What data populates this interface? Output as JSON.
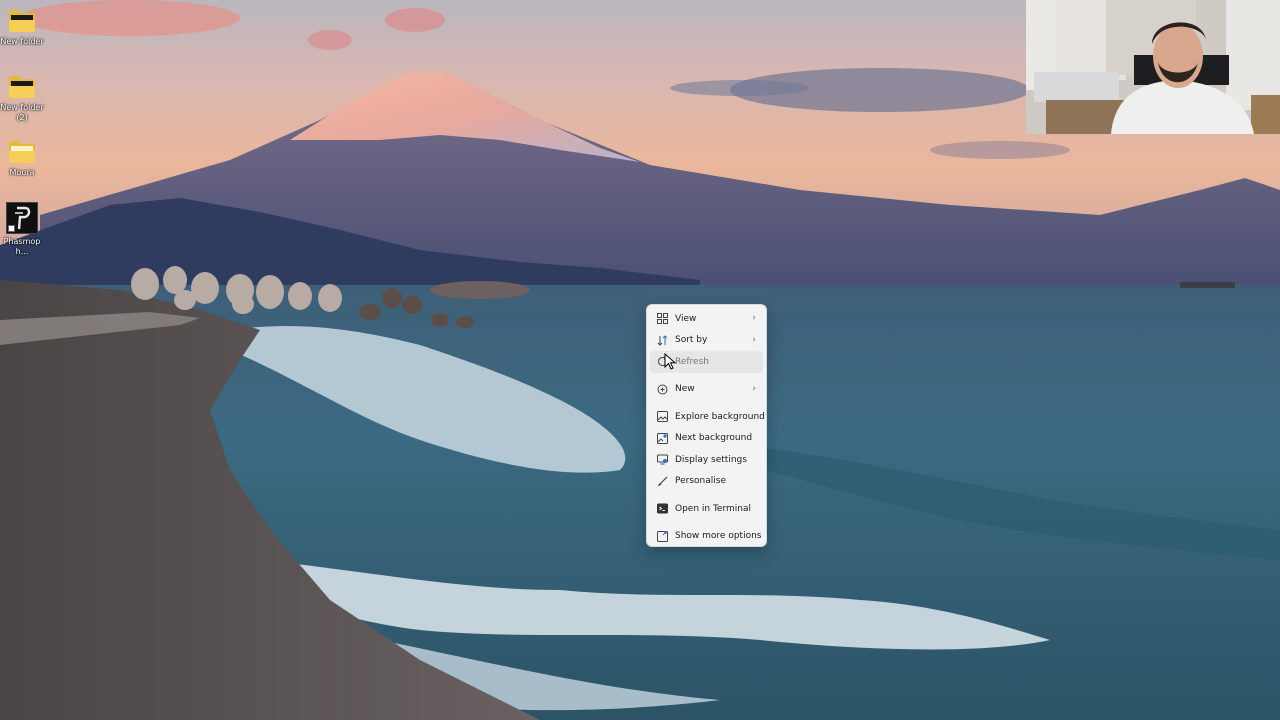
{
  "desktop": {
    "icons": [
      {
        "label": "New folder",
        "icon": "folder-icon"
      },
      {
        "label": "New folder (2)",
        "icon": "folder-icon"
      },
      {
        "label": "Moura",
        "icon": "folder-icon"
      },
      {
        "label": "Phasmoph...",
        "icon": "app-icon"
      }
    ]
  },
  "context_menu": {
    "items": [
      {
        "label": "View",
        "icon": "view-grid-icon",
        "submenu": true
      },
      {
        "label": "Sort by",
        "icon": "sort-icon",
        "submenu": true
      },
      {
        "label": "Refresh",
        "icon": "refresh-icon",
        "submenu": false
      },
      {
        "label": "New",
        "icon": "new-plus-icon",
        "submenu": true
      },
      {
        "label": "Explore background",
        "icon": "explore-image-icon",
        "submenu": false
      },
      {
        "label": "Next background",
        "icon": "next-image-icon",
        "submenu": false
      },
      {
        "label": "Display settings",
        "icon": "display-icon",
        "submenu": false
      },
      {
        "label": "Personalise",
        "icon": "brush-icon",
        "submenu": false
      },
      {
        "label": "Open in Terminal",
        "icon": "terminal-icon",
        "submenu": false
      },
      {
        "label": "Show more options",
        "icon": "more-options-icon",
        "submenu": false
      }
    ],
    "chevron": "›"
  },
  "colors": {
    "folder": "#e7b93a",
    "menu_bg": "#f3f3f3",
    "accent": "#2a6fd6"
  }
}
